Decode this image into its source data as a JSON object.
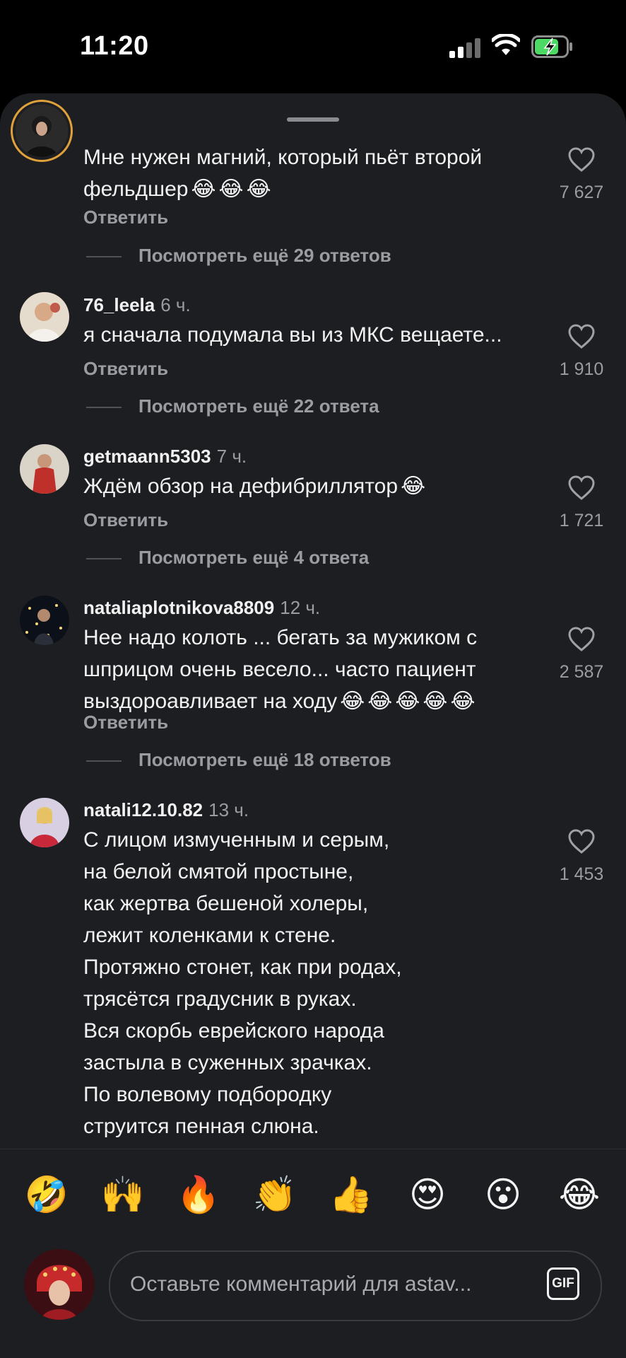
{
  "status_bar": {
    "time": "11:20"
  },
  "comments": [
    {
      "username": "",
      "age": "",
      "lines": [
        "Мне нужен магний, который пьёт второй",
        "фельдшер"
      ],
      "emoji_count": 3,
      "reply_label": "Ответить",
      "likes": "7 627",
      "more_replies": "Посмотреть ещё 29 ответов"
    },
    {
      "username": "76_leela",
      "age": "6 ч.",
      "lines": [
        "я сначала подумала вы из МКС вещаете..."
      ],
      "emoji_count": 0,
      "reply_label": "Ответить",
      "likes": "1 910",
      "more_replies": "Посмотреть ещё 22 ответа"
    },
    {
      "username": "getmaann5303",
      "age": "7 ч.",
      "lines": [
        "Ждём обзор на дефибриллятор"
      ],
      "emoji_count": 1,
      "reply_label": "Ответить",
      "likes": "1 721",
      "more_replies": "Посмотреть ещё 4 ответа"
    },
    {
      "username": "nataliaplotnikova8809",
      "age": "12 ч.",
      "lines": [
        "Нее надо колоть ... бегать за мужиком с",
        "шприцом очень весело... часто пациент",
        "выздороавливает на ходу"
      ],
      "emoji_count": 5,
      "reply_label": "Ответить",
      "likes": "2 587",
      "more_replies": "Посмотреть ещё 18 ответов"
    },
    {
      "username": "natali12.10.82",
      "age": "13 ч.",
      "lines": [
        "С лицом измученным и серым,",
        "на белой смятой простыне,",
        "как жертва бешеной холеры,",
        "лежит коленками к стене.",
        "Протяжно стонет, как при родах,",
        "трясётся градусник в руках.",
        "Вся скорбь еврейского народа",
        "застыла в суженных зрачках.",
        "По волевому подбородку",
        "струится пенная слюна."
      ],
      "emoji_count": 0,
      "reply_label": "",
      "likes": "1 453",
      "more_replies": ""
    }
  ],
  "reactions": [
    "🤣",
    "🙌",
    "🔥",
    "👏",
    "👍",
    "😍",
    "😮",
    "😂"
  ],
  "input": {
    "placeholder": "Оставьте комментарий для astav...",
    "gif_label": "GIF"
  },
  "icons": {
    "heart": "heart-outline-icon",
    "gif": "gif-icon",
    "grabber": "sheet-grabber"
  },
  "colors": {
    "sheet_bg": "#1d1e22",
    "muted_text": "#9b9ca1",
    "primary_text": "#f2f2f2",
    "story_ring": "#e0a03a"
  }
}
